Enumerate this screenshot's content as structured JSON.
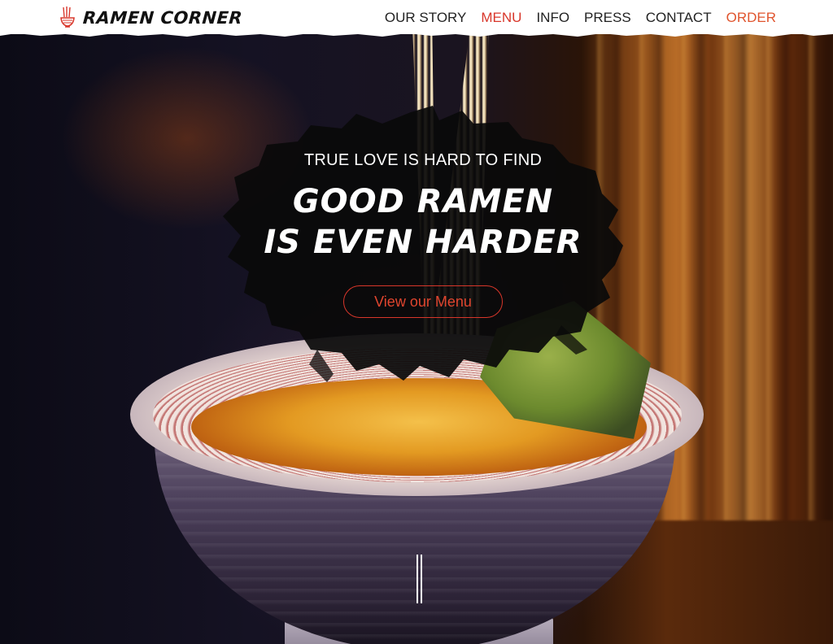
{
  "brand": {
    "name": "RAMEN CORNER",
    "logo_icon": "noodle-bowl-icon"
  },
  "nav": {
    "items": [
      {
        "label": "OUR STORY"
      },
      {
        "label": "MENU"
      },
      {
        "label": "INFO"
      },
      {
        "label": "PRESS"
      },
      {
        "label": "CONTACT"
      },
      {
        "label": "ORDER"
      }
    ],
    "active_item": "MENU"
  },
  "hero": {
    "tagline": "TRUE LOVE IS HARD TO FIND",
    "headline_line1": "GOOD RAMEN",
    "headline_line2": "IS EVEN HARDER",
    "cta_label": "View our Menu"
  },
  "colors": {
    "accent": "#d8362a",
    "order": "#e0552e",
    "text_dark": "#222222",
    "header_bg": "#ffffff"
  }
}
